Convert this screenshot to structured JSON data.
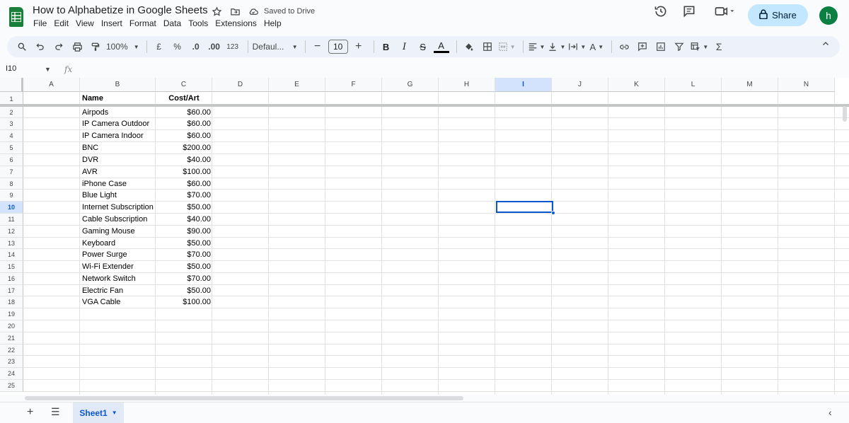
{
  "header": {
    "title": "How to Alphabetize in Google Sheets",
    "saved_status": "Saved to Drive",
    "menu": [
      "File",
      "Edit",
      "View",
      "Insert",
      "Format",
      "Data",
      "Tools",
      "Extensions",
      "Help"
    ],
    "share_label": "Share",
    "avatar_letter": "h"
  },
  "toolbar": {
    "zoom": "100%",
    "currency": "£",
    "percent": "%",
    "decrease_decimals": ".0",
    "increase_decimals": ".00",
    "format_123": "123",
    "font": "Defaul...",
    "font_size": "10"
  },
  "formula_bar": {
    "name_box": "I10",
    "fx": "fx"
  },
  "columns": [
    "A",
    "B",
    "C",
    "D",
    "E",
    "F",
    "G",
    "H",
    "I",
    "J",
    "K",
    "L",
    "M",
    "N"
  ],
  "selected_column": "I",
  "selected_row": "10",
  "rows": [
    "1",
    "2",
    "3",
    "4",
    "5",
    "6",
    "7",
    "8",
    "9",
    "10",
    "11",
    "12",
    "13",
    "14",
    "15",
    "16",
    "17",
    "18",
    "19",
    "20",
    "21",
    "22",
    "23",
    "24",
    "25"
  ],
  "table": {
    "headers": {
      "name": "Name",
      "cost": "Cost/Art"
    },
    "items": [
      {
        "name": "Airpods",
        "cost": "$60.00"
      },
      {
        "name": "IP Camera Outdoor",
        "cost": "$60.00"
      },
      {
        "name": "IP Camera Indoor",
        "cost": "$60.00"
      },
      {
        "name": "BNC",
        "cost": "$200.00"
      },
      {
        "name": "DVR",
        "cost": "$40.00"
      },
      {
        "name": "AVR",
        "cost": "$100.00"
      },
      {
        "name": "iPhone Case",
        "cost": "$60.00"
      },
      {
        "name": "Blue Light",
        "cost": "$70.00"
      },
      {
        "name": "Internet Subscription",
        "cost": "$50.00"
      },
      {
        "name": "Cable Subscription",
        "cost": "$40.00"
      },
      {
        "name": "Gaming Mouse",
        "cost": "$90.00"
      },
      {
        "name": "Keyboard",
        "cost": "$50.00"
      },
      {
        "name": "Power Surge",
        "cost": "$70.00"
      },
      {
        "name": "Wi-Fi Extender",
        "cost": "$50.00"
      },
      {
        "name": "Network Switch",
        "cost": "$70.00"
      },
      {
        "name": "Electric Fan",
        "cost": "$50.00"
      },
      {
        "name": "VGA Cable",
        "cost": "$100.00"
      }
    ]
  },
  "sheets": {
    "active": "Sheet1"
  },
  "colors": {
    "accent": "#0b57d0",
    "share_bg": "#c2e7ff",
    "sheets_green": "#188038",
    "avatar_bg": "#0b8043"
  }
}
